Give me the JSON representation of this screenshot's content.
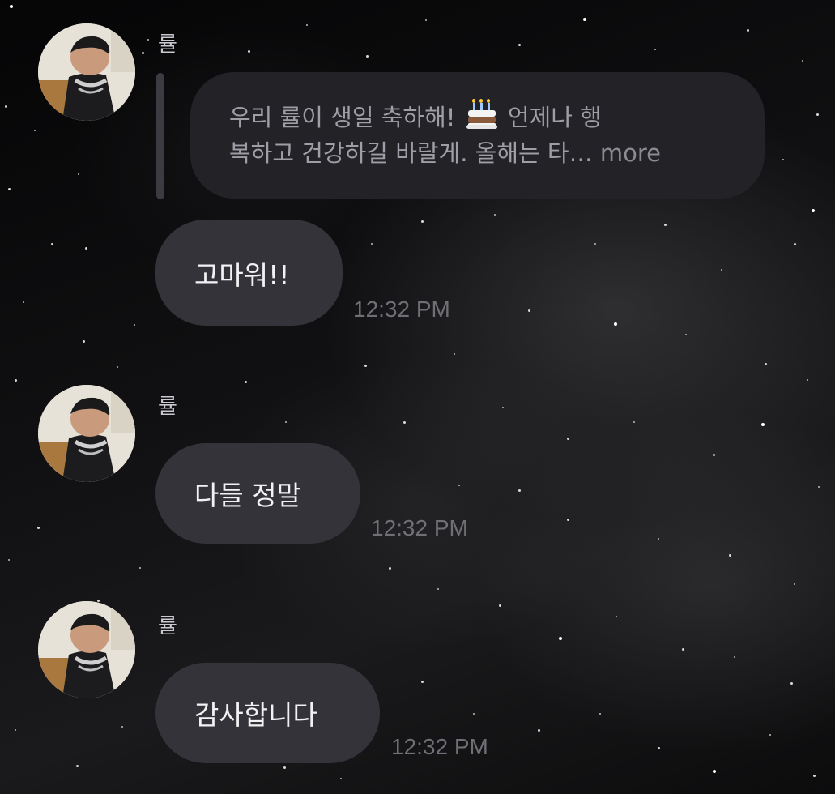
{
  "messages": [
    {
      "sender": "률",
      "reply": {
        "line1": "우리 률이 생일 축하해!",
        "line1b": "언제나 행",
        "line2": "복하고 건강하길 바랄게. 올해는 타…",
        "more": "more",
        "emoji": "birthday-cake"
      },
      "text": "고마워!!",
      "time": "12:32 PM"
    },
    {
      "sender": "률",
      "text": "다들 정말",
      "time": "12:32 PM"
    },
    {
      "sender": "률",
      "text": "감사합니다",
      "time": "12:32 PM"
    }
  ],
  "colors": {
    "background": "#0b0b0c",
    "bubble": "#333339",
    "reply_bubble": "#222227",
    "timestamp": "#6f6f76"
  }
}
